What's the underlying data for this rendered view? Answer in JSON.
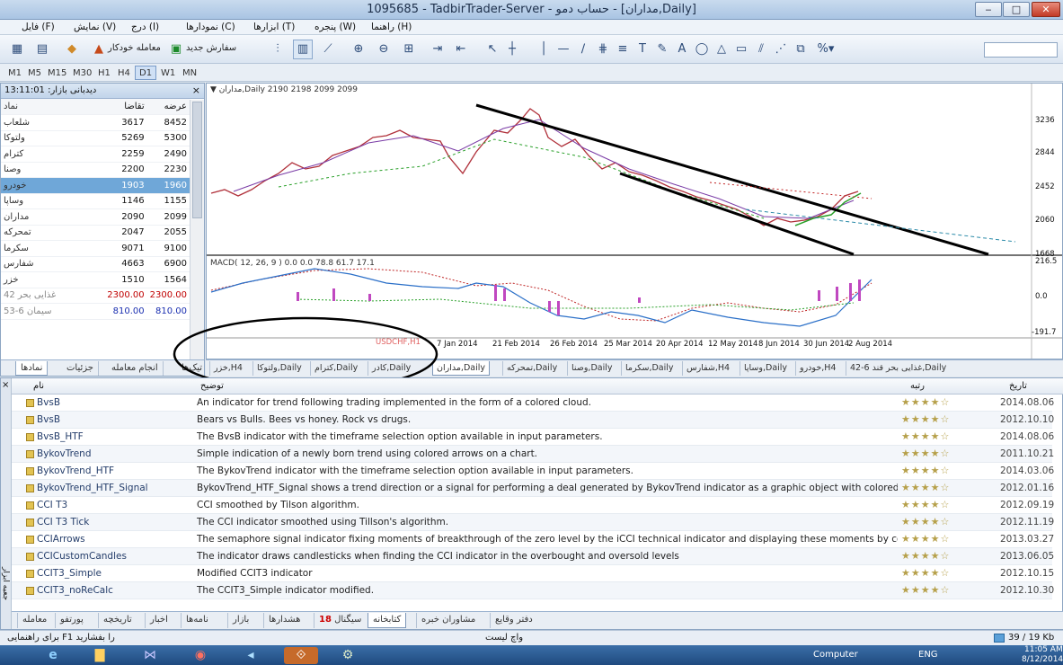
{
  "window": {
    "title": "1095685 - TadbirTrader-Server - حساب دمو - [مداران,Daily]",
    "minimize": "‒",
    "maximize": "□",
    "close": "✕"
  },
  "menu": [
    "فایل (F)",
    "نمایش (V)",
    "درج (I)",
    "نمودارها (C)",
    "ابزارها (T)",
    "پنجره (W)",
    "راهنما (H)"
  ],
  "toolbar": {
    "new_order": "سفارش جدید",
    "auto_trade": "معامله خودکار"
  },
  "timeframes": [
    "M1",
    "M5",
    "M15",
    "M30",
    "H1",
    "H4",
    "D1",
    "W1",
    "MN"
  ],
  "active_timeframe": "D1",
  "market_watch": {
    "header": "دیدبانی بازار: 13:11:01",
    "col_symbol": "نماد",
    "col_bid": "تقاضا",
    "col_ask": "عرضه",
    "rows": [
      {
        "symbol": "شلعاب",
        "bid": "3617",
        "ask": "8452"
      },
      {
        "symbol": "ولتوکا",
        "bid": "5269",
        "ask": "5300"
      },
      {
        "symbol": "کترام",
        "bid": "2259",
        "ask": "2490"
      },
      {
        "symbol": "وصنا",
        "bid": "2200",
        "ask": "2230"
      },
      {
        "symbol": "خودرو",
        "bid": "1903",
        "ask": "1960"
      },
      {
        "symbol": "وساپا",
        "bid": "1146",
        "ask": "1155"
      },
      {
        "symbol": "مداران",
        "bid": "2090",
        "ask": "2099"
      },
      {
        "symbol": "تمحرکه",
        "bid": "2047",
        "ask": "2055"
      },
      {
        "symbol": "سکرما",
        "bid": "9071",
        "ask": "9100"
      },
      {
        "symbol": "شفارس",
        "bid": "4663",
        "ask": "6900"
      },
      {
        "symbol": "خزر",
        "bid": "1510",
        "ask": "1564"
      },
      {
        "symbol": "غذایی بحر 42",
        "bid": "2300.00",
        "ask": "2300.00"
      },
      {
        "symbol": "سیمان 6-53",
        "bid": "810.00",
        "ask": "810.00"
      }
    ],
    "tabs": [
      "نمادها",
      "جزئیات",
      "انجام معامله",
      "تیک‌ها"
    ]
  },
  "chart": {
    "info": "▼ مداران,Daily  2190 2198 2099 2099",
    "macd_label": "MACD( 12, 26, 9 ) 0.0 0.0 78.8 61.7 17.1",
    "price_labels": [
      "3236",
      "2844",
      "2452",
      "2060",
      "1668",
      "216.5",
      "0.0",
      "-191.7"
    ],
    "x_labels": [
      "7 Jan 2014",
      "21 Feb 2014",
      "26 Feb 2014",
      "25 Mar 2014",
      "20 Apr 2014",
      "12 May 2014",
      "8 Jun 2014",
      "30 Jun 2014",
      "2 Aug 2014"
    ],
    "watermark": "USDCHF,H1",
    "tabs": [
      "خزر,H4",
      "ولتوکا,Daily",
      "کترام,Daily",
      "کادر,Daily",
      "مداران,Daily",
      "تمحرکه,Daily",
      "وصنا,Daily",
      "سکرما,Daily",
      "شفارس,H4",
      "وساپا,Daily",
      "خودرو,H4",
      "غذایی بحر قند 6-42,Daily"
    ]
  },
  "toolbox": {
    "col_name": "نام",
    "col_desc": "توضیح",
    "col_rating": "رتبه",
    "col_date": "تاریخ",
    "rows": [
      {
        "name": "BvsB",
        "desc": "An indicator for trend following trading implemented in the form of a colored cloud.",
        "date": "2014.08.06"
      },
      {
        "name": "BvsB",
        "desc": "Bears vs Bulls.  Bees vs honey.  Rock vs drugs.",
        "date": "2012.10.10"
      },
      {
        "name": "BvsB_HTF",
        "desc": "The BvsB indicator with the timeframe selection option available in input parameters.",
        "date": "2014.08.06"
      },
      {
        "name": "BykovTrend",
        "desc": "Simple indication of a newly born trend using colored arrows on a chart.",
        "date": "2011.10.21"
      },
      {
        "name": "BykovTrend_HTF",
        "desc": "The BykovTrend indicator with the timeframe selection option available in input parameters.",
        "date": "2014.03.06"
      },
      {
        "name": "BykovTrend_HTF_Signal",
        "desc": "BykovTrend_HTF_Signal shows a trend direction or a signal for performing a deal generated by BykovTrend indicator as a graphic object with colored trend i...",
        "date": "2012.01.16"
      },
      {
        "name": "CCI T3",
        "desc": "CCI smoothed by Tilson algorithm.",
        "date": "2012.09.19"
      },
      {
        "name": "CCI T3 Tick",
        "desc": "The CCI indicator smoothed using Tillson's algorithm.",
        "date": "2012.11.19"
      },
      {
        "name": "CCIArrows",
        "desc": "The semaphore signal indicator fixing moments of breakthrough of the zero level by the iCCI technical indicator and displaying these moments by color poi...",
        "date": "2013.03.27"
      },
      {
        "name": "CCICustomCandles",
        "desc": "The indicator draws candlesticks when finding the CCI indicator in the overbought and oversold levels",
        "date": "2013.06.05"
      },
      {
        "name": "CCIT3_Simple",
        "desc": "Modified CCIT3 indicator",
        "date": "2012.10.15"
      },
      {
        "name": "CCIT3_noReCalc",
        "desc": "The CCIT3_Simple indicator modified.",
        "date": "2012.10.30"
      }
    ],
    "tabs": [
      "معامله",
      "پورتفو",
      "تاریخچه",
      "اخبار",
      "نامه‌ها",
      "بازار",
      "هشدارها",
      "سیگنال",
      "کتابخانه",
      "مشاوران خبره",
      "دفتر وقایع"
    ],
    "side_label": "جعبه ابزار",
    "signal_badge": "18"
  },
  "status": {
    "help": "برای راهنمایی F1 را بفشارید",
    "default": "واچ لیست",
    "traffic": "39 / 19 Kb"
  },
  "taskbar": {
    "computer": "Computer",
    "lang": "ENG",
    "time": "11:05 AM",
    "date": "8/12/2014"
  }
}
